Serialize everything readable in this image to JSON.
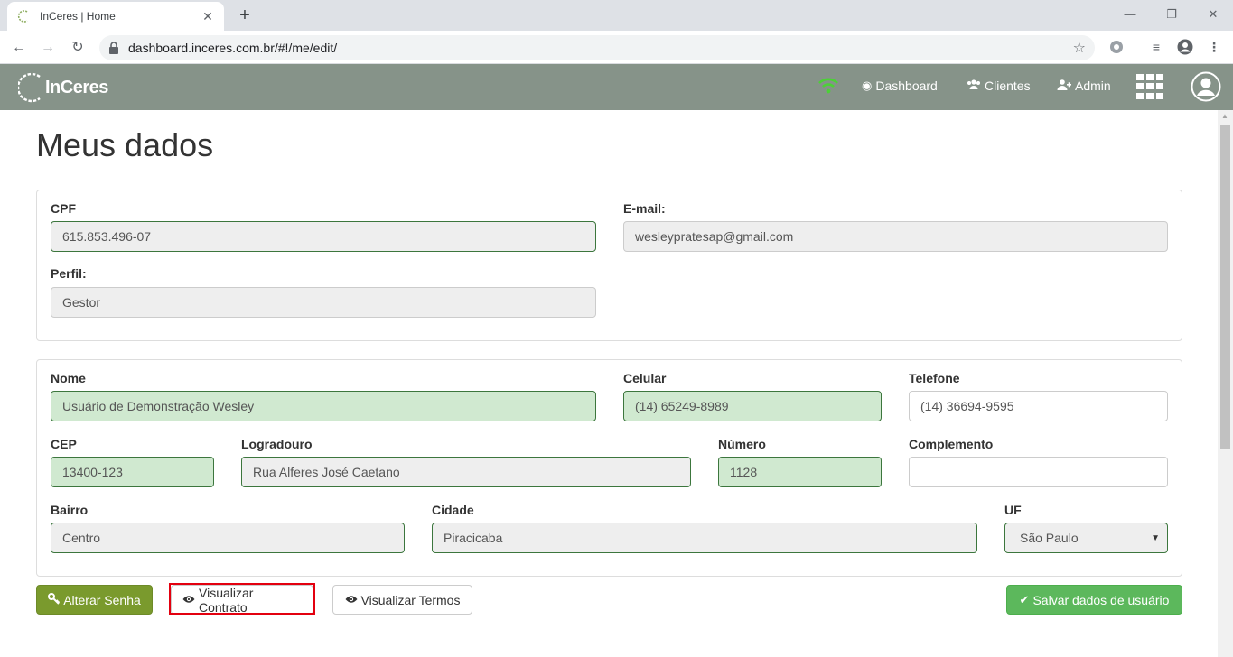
{
  "browser": {
    "tab_title": "InCeres | Home",
    "tab_close": "✕",
    "new_tab": "+",
    "url": "dashboard.inceres.com.br/#!/me/edit/",
    "win_minimize": "—",
    "win_restore": "❐",
    "win_close": "✕"
  },
  "navbar": {
    "logo_text": "InCeres",
    "links": [
      {
        "label": "Dashboard",
        "icon": "dashboard-icon"
      },
      {
        "label": "Clientes",
        "icon": "users-icon"
      },
      {
        "label": "Admin",
        "icon": "user-plus-icon"
      }
    ],
    "brand_color": "#869389"
  },
  "page": {
    "title": "Meus dados"
  },
  "account": {
    "cpf_label": "CPF",
    "cpf_value": "615.853.496-07",
    "email_label": "E-mail:",
    "email_value": "wesleypratesap@gmail.com",
    "perfil_label": "Perfil:",
    "perfil_value": "Gestor"
  },
  "personal": {
    "nome_label": "Nome",
    "nome_value": "Usuário de Demonstração Wesley",
    "celular_label": "Celular",
    "celular_value": "(14) 65249-8989",
    "telefone_label": "Telefone",
    "telefone_value": "(14) 36694-9595",
    "cep_label": "CEP",
    "cep_value": "13400-123",
    "logradouro_label": "Logradouro",
    "logradouro_value": "Rua Alferes José Caetano",
    "numero_label": "Número",
    "numero_value": "1128",
    "complemento_label": "Complemento",
    "complemento_value": "",
    "bairro_label": "Bairro",
    "bairro_value": "Centro",
    "cidade_label": "Cidade",
    "cidade_value": "Piracicaba",
    "uf_label": "UF",
    "uf_value": "São Paulo"
  },
  "actions": {
    "alterar_senha": "Alterar Senha",
    "visualizar_contrato": "Visualizar Contrato",
    "visualizar_termos": "Visualizar Termos",
    "salvar": "Salvar dados de usuário"
  }
}
